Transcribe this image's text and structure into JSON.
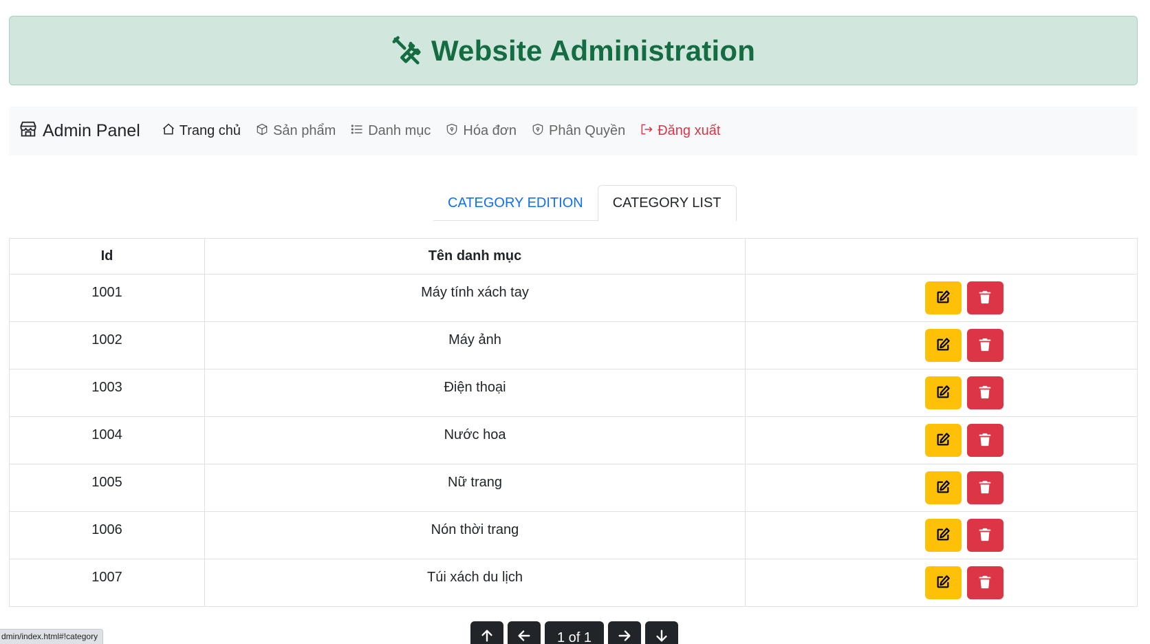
{
  "header": {
    "title": "Website Administration",
    "icon": "tools-icon"
  },
  "navbar": {
    "brand": "Admin Panel",
    "items": [
      {
        "label": "Trang chủ",
        "icon": "house-icon"
      },
      {
        "label": "Sản phẩm",
        "icon": "box-icon"
      },
      {
        "label": "Danh mục",
        "icon": "list-icon"
      },
      {
        "label": "Hóa đơn",
        "icon": "shield-icon"
      },
      {
        "label": "Phân Quyền",
        "icon": "shield-icon"
      },
      {
        "label": "Đăng xuất",
        "icon": "logout-icon"
      }
    ]
  },
  "tabs": [
    {
      "label": "CATEGORY EDITION"
    },
    {
      "label": "CATEGORY LIST"
    }
  ],
  "table": {
    "headers": [
      "Id",
      "Tên danh mục",
      ""
    ],
    "rows": [
      {
        "id": "1001",
        "name": "Máy tính xách tay"
      },
      {
        "id": "1002",
        "name": "Máy ảnh"
      },
      {
        "id": "1003",
        "name": "Điện thoại"
      },
      {
        "id": "1004",
        "name": "Nước hoa"
      },
      {
        "id": "1005",
        "name": "Nữ trang"
      },
      {
        "id": "1006",
        "name": "Nón thời trang"
      },
      {
        "id": "1007",
        "name": "Túi xách du lịch"
      }
    ]
  },
  "pagination": {
    "page_label": "1 of 1"
  },
  "status_url": "dmin/index.html#!category",
  "colors": {
    "banner_bg": "#d1e7dd",
    "banner_text": "#146c43",
    "edit": "#ffc107",
    "delete": "#dc3545",
    "link": "#0d6efd"
  }
}
